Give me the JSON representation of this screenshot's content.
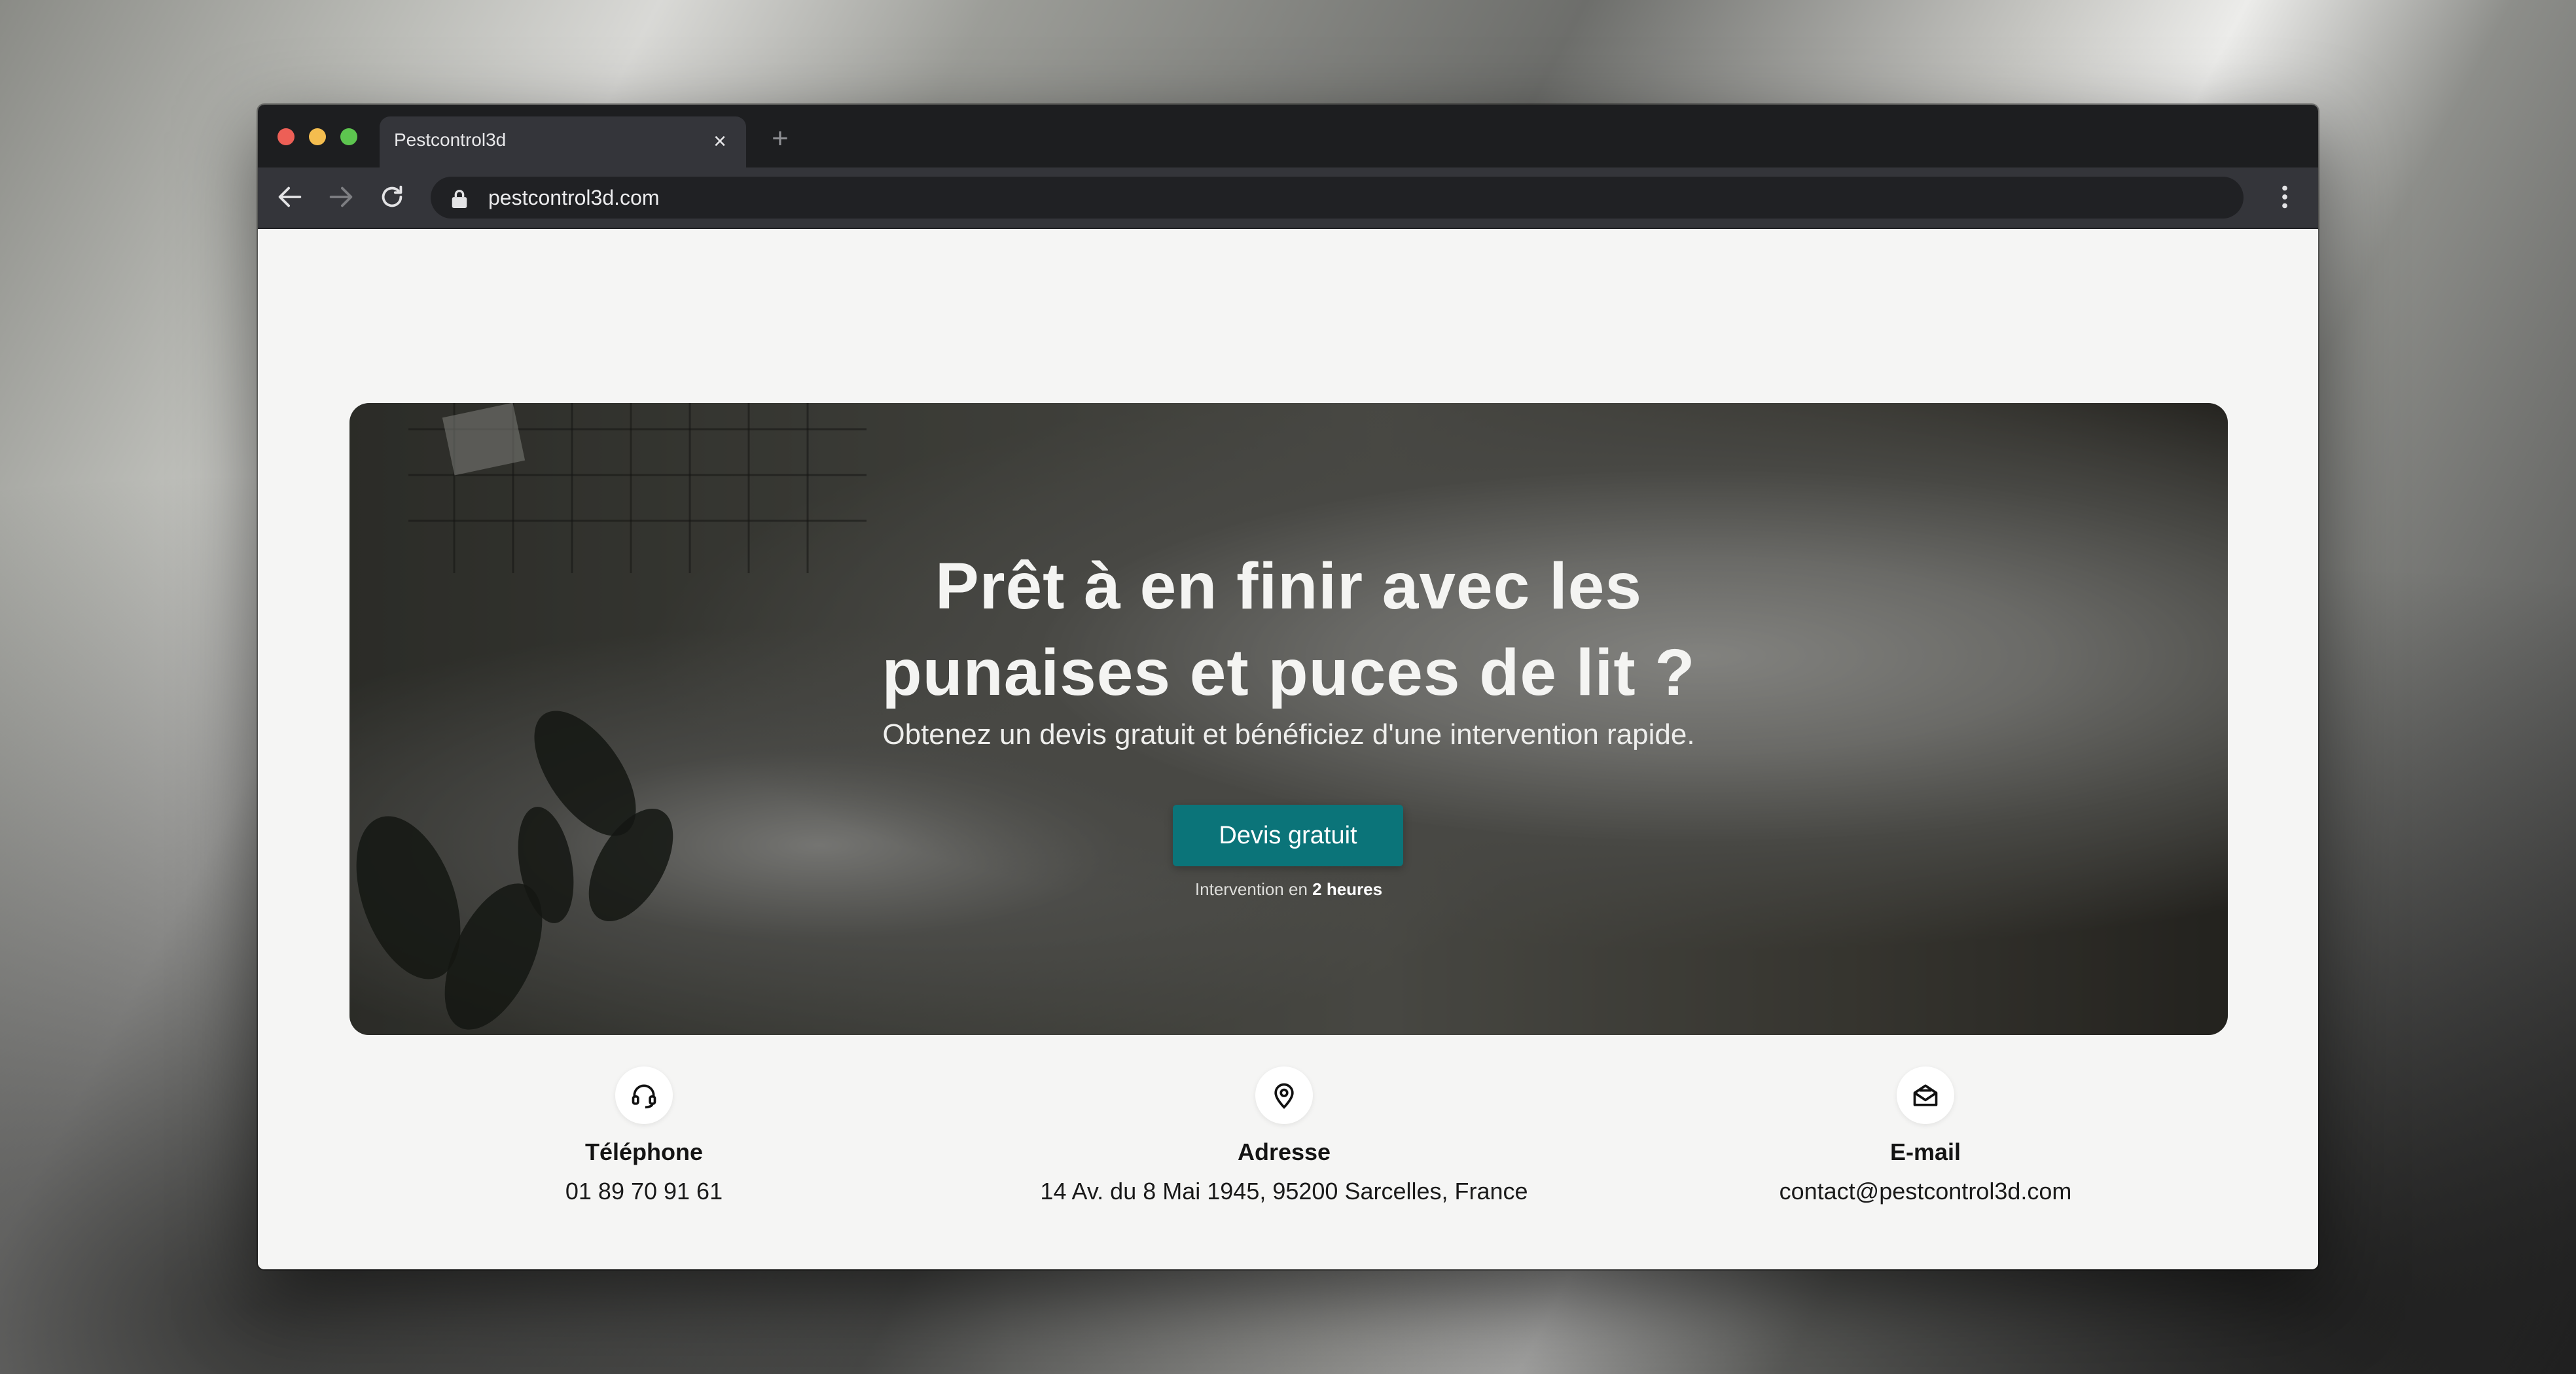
{
  "browser": {
    "tab_title": "Pestcontrol3d",
    "tab_close": "×",
    "new_tab": "+",
    "url": "pestcontrol3d.com"
  },
  "hero": {
    "title_line1": "Prêt à en finir avec les",
    "title_line2": "punaises et puces de lit ?",
    "subtitle": "Obtenez un devis gratuit et bénéficiez d'une intervention rapide.",
    "cta_label": "Devis gratuit",
    "note_prefix": "Intervention en ",
    "note_bold": "2 heures"
  },
  "contacts": {
    "phone": {
      "icon": "headset-icon",
      "label": "Téléphone",
      "value": "01 89 70 91 61"
    },
    "address": {
      "icon": "map-pin-icon",
      "label": "Adresse",
      "value": "14 Av. du 8 Mai 1945, 95200 Sarcelles, France"
    },
    "email": {
      "icon": "envelope-open-icon",
      "label": "E-mail",
      "value": "contact@pestcontrol3d.com"
    }
  },
  "colors": {
    "accent": "#0b7479",
    "chrome_dark": "#1d1e20",
    "chrome_toolbar": "#34353a",
    "page_bg": "#f5f5f4"
  }
}
